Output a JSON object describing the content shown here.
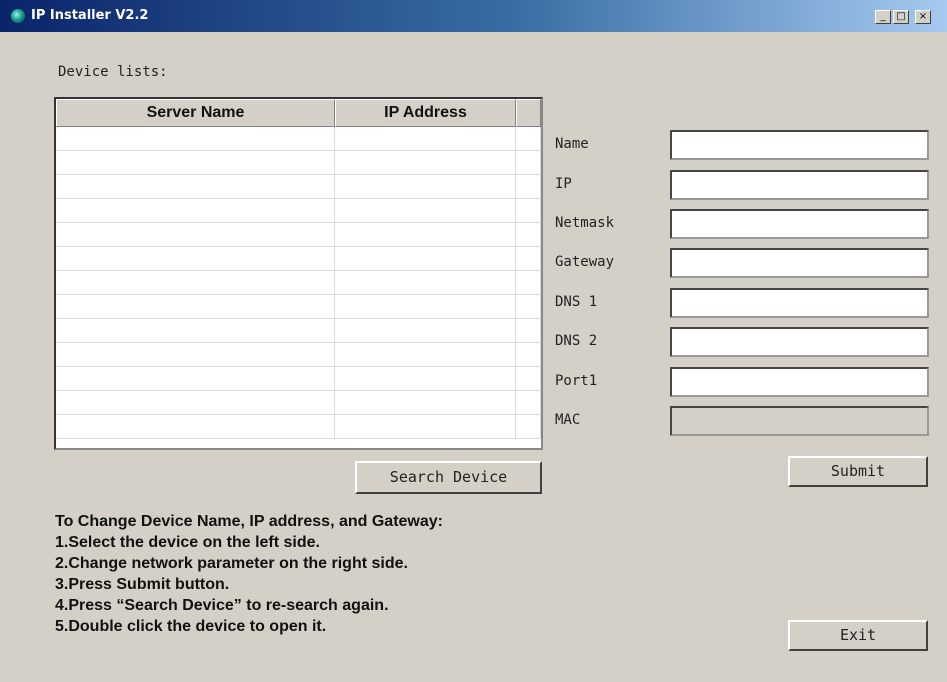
{
  "window": {
    "title": "IP Installer V2.2",
    "minimize": "_",
    "maximize": "□",
    "close": "×",
    "icon": "app-icon"
  },
  "device_list": {
    "label": "Device lists:",
    "columns": [
      "Server Name",
      "IP Address"
    ],
    "rows": []
  },
  "form": {
    "fields": [
      {
        "label": "Name",
        "value": ""
      },
      {
        "label": "IP",
        "value": ""
      },
      {
        "label": "Netmask",
        "value": ""
      },
      {
        "label": "Gateway",
        "value": ""
      },
      {
        "label": "DNS 1",
        "value": ""
      },
      {
        "label": "DNS 2",
        "value": ""
      },
      {
        "label": "Port1",
        "value": ""
      },
      {
        "label": "MAC",
        "value": ""
      }
    ]
  },
  "buttons": {
    "search": "Search Device",
    "submit": "Submit",
    "exit": "Exit"
  },
  "instructions": {
    "heading": "To Change Device Name, IP address, and Gateway:",
    "steps": [
      "1.Select the device on the left side.",
      "2.Change network parameter on the right side.",
      "3.Press Submit button.",
      "4.Press  “Search Device”  to re-search again.",
      "5.Double click the device to open it."
    ]
  },
  "colors": {
    "background": "#d4d0c8",
    "titlebar_start": "#0a246a",
    "titlebar_end": "#a6caf0"
  }
}
